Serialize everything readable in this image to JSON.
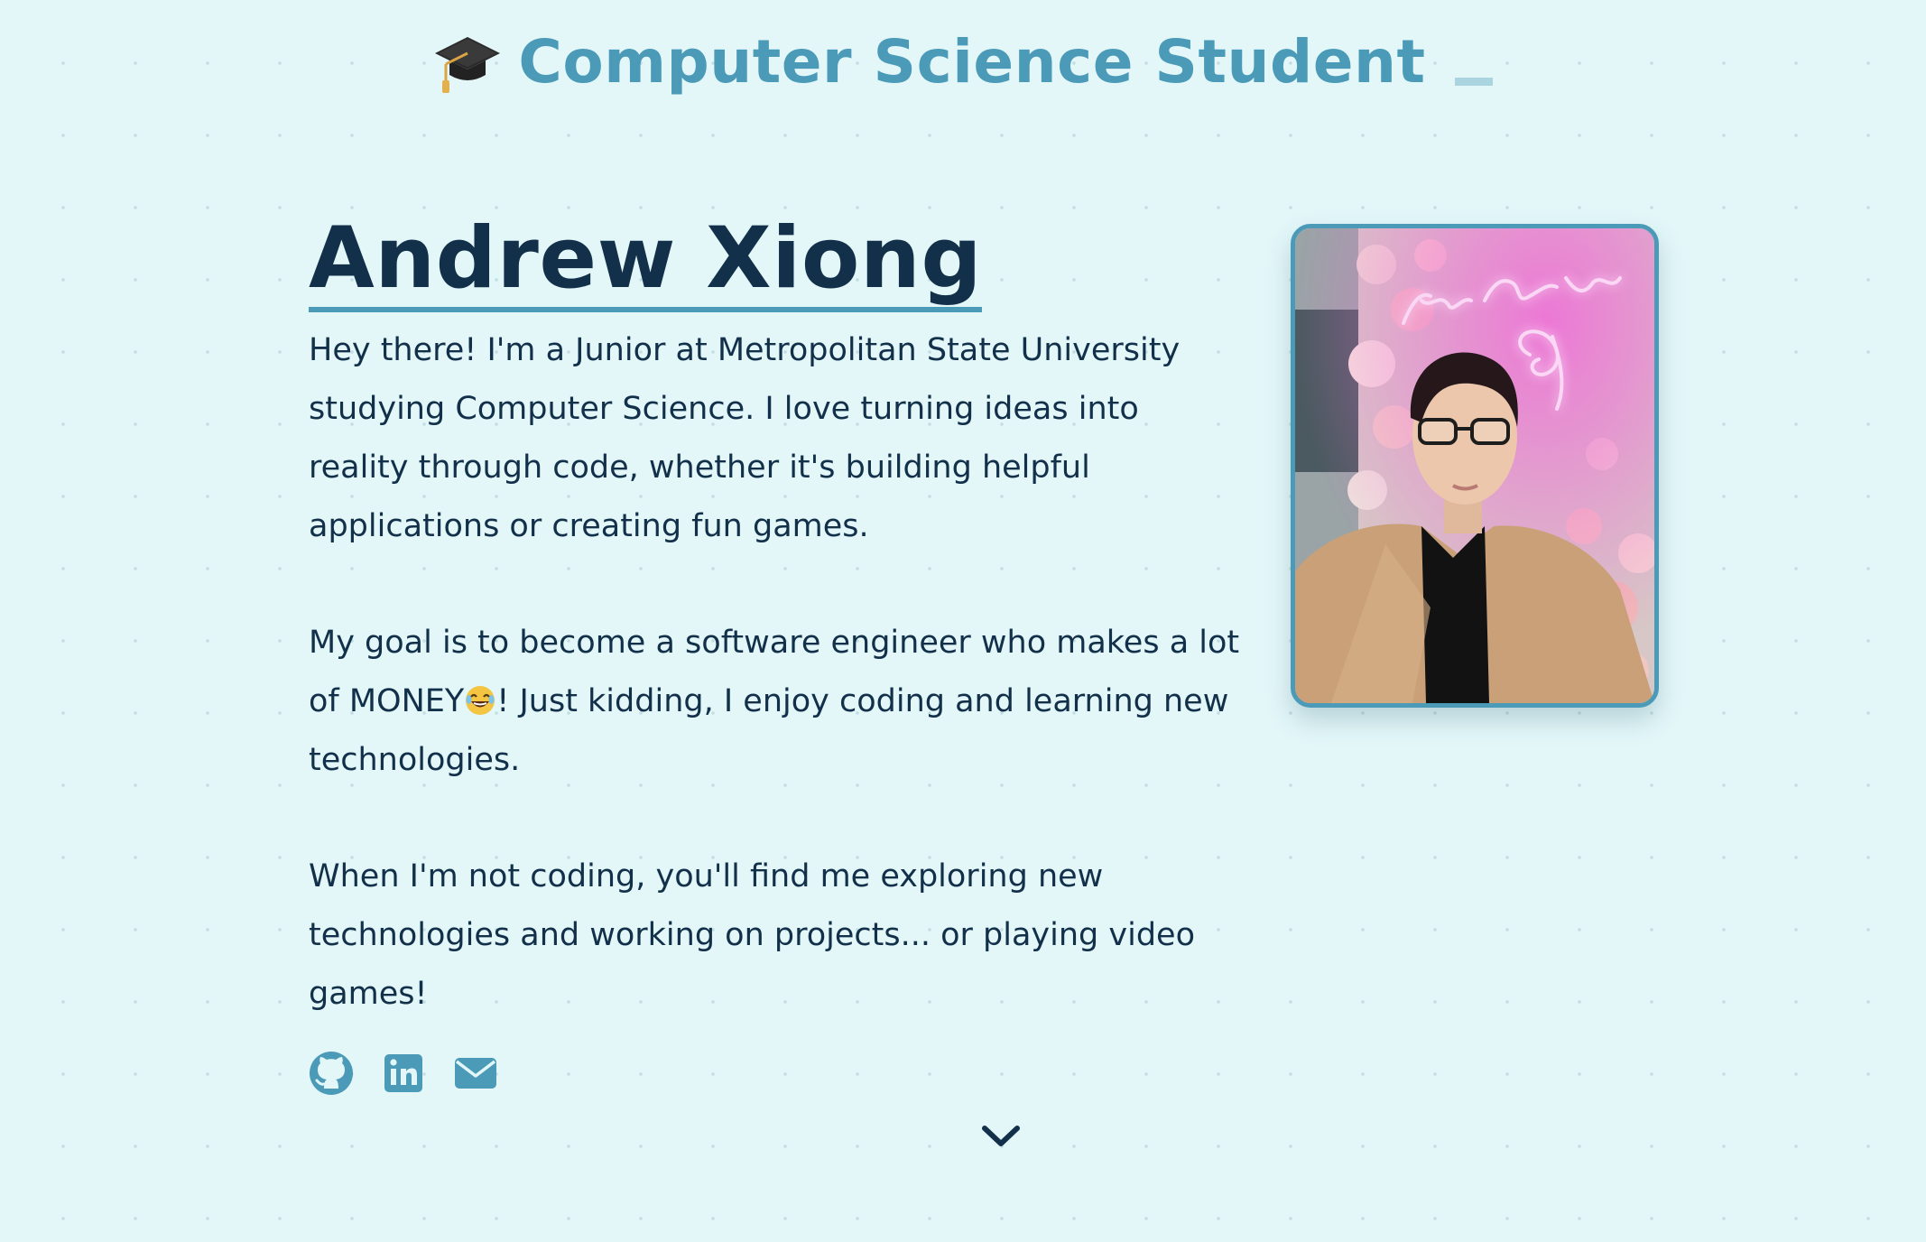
{
  "header": {
    "title": "Computer Science Student",
    "icon": "graduation-cap-icon"
  },
  "profile": {
    "name": "Andrew Xiong",
    "bio": [
      "Hey there! I'm a Junior at Metropolitan State University studying Computer Science. I love turning ideas into reality through code, whether it's building helpful applications or creating fun games.",
      "When I'm not coding, you'll find me exploring new technologies and working on projects... or playing video games!"
    ],
    "goal_before_emoji": "My goal is to become a software engineer who makes a lot of MONEY",
    "goal_after_emoji": "! Just kidding, I enjoy coding and learning new technologies.",
    "neon_sign_text": "you are my best friend"
  },
  "socials": [
    {
      "name": "GitHub",
      "icon": "github-icon"
    },
    {
      "name": "LinkedIn",
      "icon": "linkedin-icon"
    },
    {
      "name": "Email",
      "icon": "mail-icon"
    }
  ],
  "colors": {
    "background": "#e3f7f9",
    "accent": "#4a9ab8",
    "text": "#12304a"
  }
}
